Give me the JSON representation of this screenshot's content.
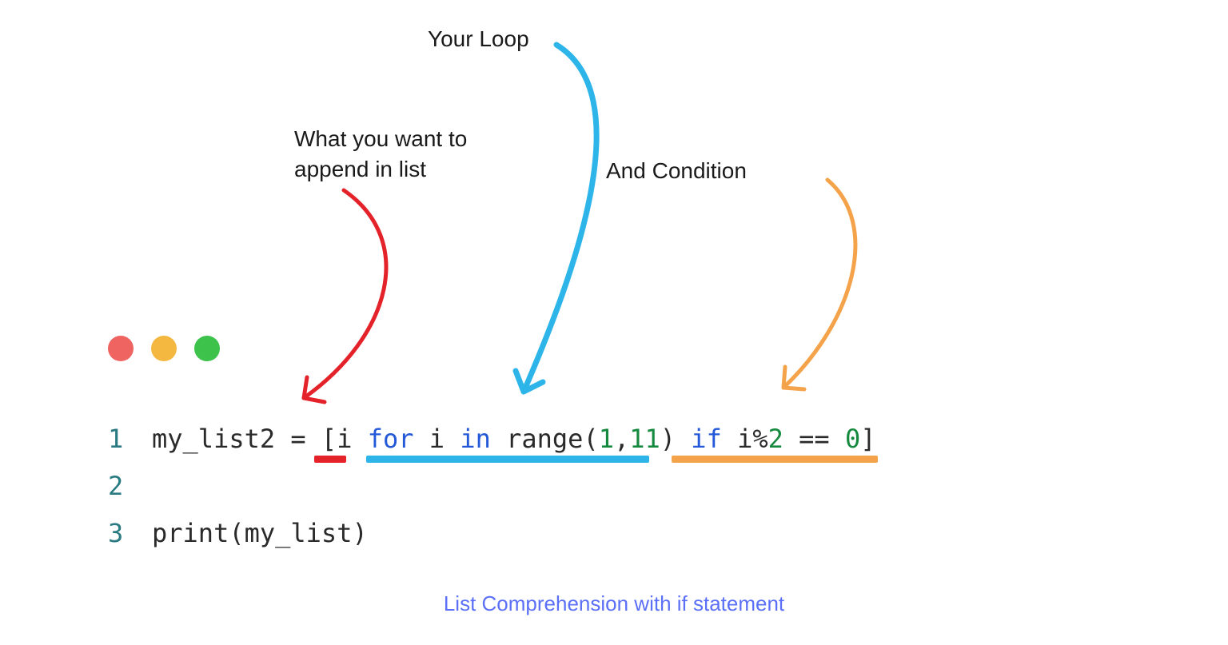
{
  "annotations": {
    "loop": "Your Loop",
    "append_line1": "What you want to",
    "append_line2": "append in list",
    "condition": "And Condition"
  },
  "code": {
    "line1": {
      "lineno": "1",
      "t1": "my_list2 = [i ",
      "kw_for": "for",
      "t2": " i ",
      "kw_in": "in",
      "t3": " range(",
      "n1": "1",
      "t4": ",",
      "n2": "11",
      "t5": ") ",
      "kw_if": "if",
      "t6": " i%",
      "n3": "2",
      "t7": " == ",
      "n4": "0",
      "t8": "]"
    },
    "line2": {
      "lineno": "2"
    },
    "line3": {
      "lineno": "3",
      "text": "print(my_list)"
    }
  },
  "caption": "List Comprehension with if statement",
  "colors": {
    "red": "#e4222a",
    "sky": "#2db5e9",
    "orange": "#f5a34b"
  }
}
